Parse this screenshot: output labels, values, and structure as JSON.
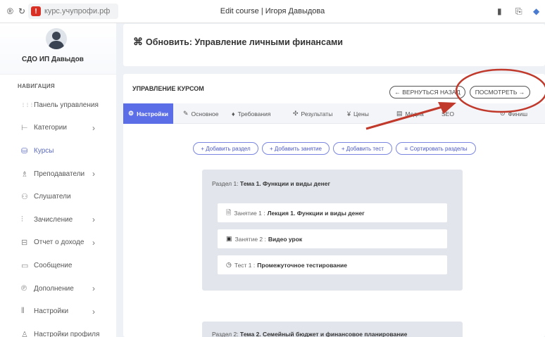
{
  "browser": {
    "url": "курс.учупрофи.рф",
    "tab_title": "Edit course | Игоря Давыдова"
  },
  "sidebar": {
    "org_name": "СДО ИП Давыдов",
    "nav_label": "НАВИГАЦИЯ",
    "items": [
      {
        "label": "Панель управления",
        "icon": "grid-icon",
        "chevron": false,
        "active": false
      },
      {
        "label": "Категории",
        "icon": "category-icon",
        "chevron": true,
        "active": false
      },
      {
        "label": "Курсы",
        "icon": "courses-icon",
        "chevron": false,
        "active": true
      },
      {
        "label": "Преподаватели",
        "icon": "teacher-icon",
        "chevron": true,
        "active": false
      },
      {
        "label": "Слушатели",
        "icon": "students-icon",
        "chevron": false,
        "active": false
      },
      {
        "label": "Зачисление",
        "icon": "enroll-icon",
        "chevron": true,
        "active": false
      },
      {
        "label": "Отчет о доходе",
        "icon": "report-icon",
        "chevron": true,
        "active": false
      },
      {
        "label": "Сообщение",
        "icon": "message-icon",
        "chevron": false,
        "active": false
      },
      {
        "label": "Дополнение",
        "icon": "addon-icon",
        "chevron": true,
        "active": false
      },
      {
        "label": "Настройки",
        "icon": "settings-icon",
        "chevron": true,
        "active": false
      },
      {
        "label": "Настройки профиля",
        "icon": "profile-icon",
        "chevron": false,
        "active": false
      }
    ]
  },
  "header": {
    "course_title": "Обновить: Управление личными финансами"
  },
  "manage": {
    "title": "УПРАВЛЕНИЕ КУРСОМ",
    "back_button": "← ВЕРНУТЬСЯ НАЗАД",
    "view_button": "ПОСМОТРЕТЬ →",
    "tabs": [
      "Настройки",
      "Основное",
      "Требования",
      "Результаты",
      "Цены",
      "Медиа",
      "SEO",
      "Финиш"
    ],
    "actions": [
      "+ Добавить раздел",
      "+ Добавить занятие",
      "+ Добавить тест",
      "Сортировать разделы"
    ]
  },
  "sections": [
    {
      "prefix": "Раздел 1:",
      "title": "Тема 1. Функции и виды денег",
      "items": [
        {
          "prefix": "Занятие 1 :",
          "title": "Лекция 1. Функции и виды денег",
          "icon": "document-icon"
        },
        {
          "prefix": "Занятие 2 :",
          "title": "Видео урок",
          "icon": "video-icon"
        },
        {
          "prefix": "Тест 1 :",
          "title": "Промежуточное тестирование",
          "icon": "quiz-icon"
        }
      ]
    },
    {
      "prefix": "Раздел 2:",
      "title": "Тема 2. Семейный бюджет и финансовое планирование",
      "items": []
    }
  ],
  "colors": {
    "accent": "#5b6ee8",
    "annotation": "#c0392b"
  }
}
